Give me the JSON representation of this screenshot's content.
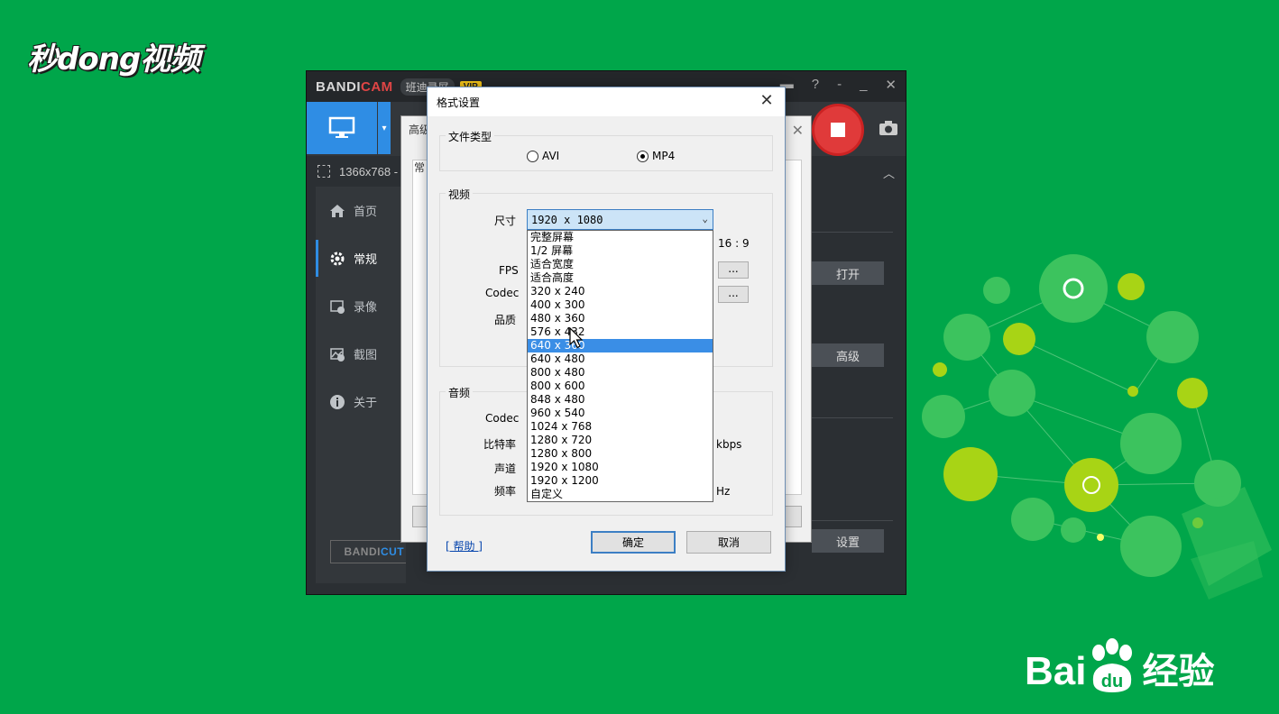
{
  "watermarks": {
    "top_left": "秒dong视频",
    "bottom_right_prefix": "Bai",
    "bottom_right_du": "du",
    "bottom_right_suffix": "经验"
  },
  "app": {
    "brand_bandi": "BANDI",
    "brand_cam": "CAM",
    "brand_sub": "班迪录屏",
    "vip": "VIP",
    "region_size": "1366x768 -",
    "sidebar": [
      {
        "label": "首页",
        "icon": "home-icon"
      },
      {
        "label": "常规",
        "icon": "gear-icon"
      },
      {
        "label": "录像",
        "icon": "video-icon"
      },
      {
        "label": "截图",
        "icon": "image-icon"
      },
      {
        "label": "关于",
        "icon": "info-icon"
      }
    ],
    "bandicut_bandi": "BANDI",
    "bandicut_cut": "CUT ↗",
    "right_buttons": {
      "open": "打开",
      "advanced": "高级",
      "settings": "设置"
    }
  },
  "settings_window": {
    "tab_label": "高级",
    "tab_chip": "常"
  },
  "dialog": {
    "title": "格式设置",
    "filetype_group": "文件类型",
    "radio_avi": "AVI",
    "radio_mp4": "MP4",
    "selected_format": "MP4",
    "video_group": "视频",
    "size_label": "尺寸",
    "size_value": "1920 x 1080",
    "aspect_ratio": "16 : 9",
    "fps_label": "FPS",
    "codec_label": "Codec",
    "quality_label": "品质",
    "dots": "...",
    "size_options": [
      "完整屏幕",
      "1/2 屏幕",
      "适合宽度",
      "适合高度",
      "320 x 240",
      "400 x 300",
      "480 x 360",
      "576 x 432",
      "640 x 360",
      "640 x 480",
      "800 x 480",
      "800 x 600",
      "848 x 480",
      "960 x 540",
      "1024 x 768",
      "1280 x 720",
      "1280 x 800",
      "1920 x 1080",
      "1920 x 1200",
      "自定义"
    ],
    "highlighted_option": "640 x 360",
    "audio_group": "音频",
    "audio_codec_label": "Codec",
    "bitrate_label": "比特率",
    "bitrate_unit": "kbps",
    "channel_label": "声道",
    "freq_label": "频率",
    "freq_unit": "Hz",
    "help": "[ 帮助 ]",
    "ok": "确定",
    "cancel": "取消"
  }
}
